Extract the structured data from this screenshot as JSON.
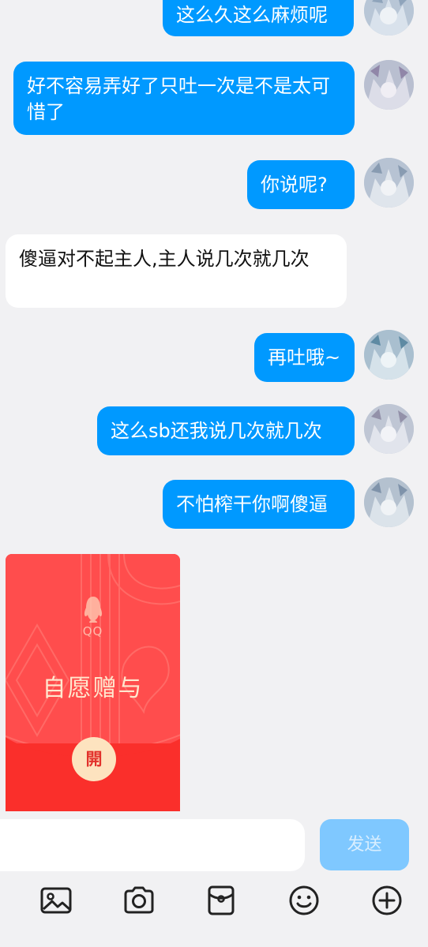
{
  "messages": [
    {
      "side": "out",
      "text": "这么久这么麻烦呢"
    },
    {
      "side": "out",
      "text": "好不容易弄好了只吐一次是不是太可惜了"
    },
    {
      "side": "out",
      "text": "你说呢?"
    },
    {
      "side": "in",
      "text": "傻逼对不起主人,主人说几次就几次"
    },
    {
      "side": "out",
      "text": "再吐哦~"
    },
    {
      "side": "out",
      "text": "这么sb还我说几次就几次"
    },
    {
      "side": "out",
      "text": "不怕榨干你啊傻逼"
    }
  ],
  "red_packet": {
    "brand": "QQ",
    "title": "自愿赠与",
    "open_label": "開"
  },
  "input": {
    "value": "",
    "placeholder": "",
    "send_label": "发送"
  },
  "toolbar": {
    "icons": [
      "image-icon",
      "camera-icon",
      "red-packet-icon",
      "emoji-icon",
      "plus-icon"
    ]
  },
  "colors": {
    "outgoing_bubble": "#0099ff",
    "incoming_bubble": "#ffffff",
    "background": "#f1f1f3",
    "send_button": "#7fc8ff",
    "red_packet": "#ff4a4a"
  }
}
